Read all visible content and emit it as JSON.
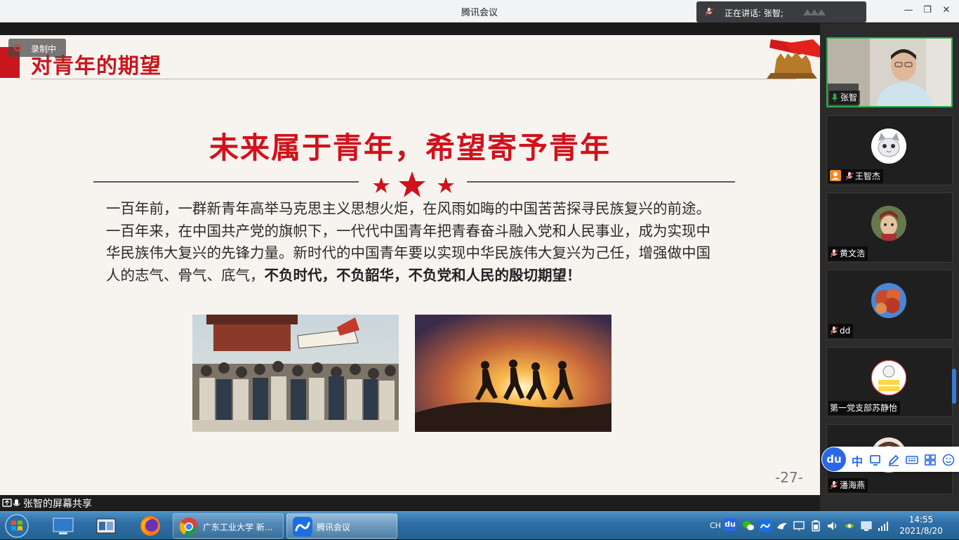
{
  "window": {
    "title": "腾讯会议",
    "speaking_text": "正在讲话: 张智;",
    "controls": [
      "—",
      "❐",
      "✕"
    ]
  },
  "slide": {
    "recording_label": "录制中",
    "heading": "对青年的期望",
    "main_title": "未来属于青年，希望寄予青年",
    "paragraph_normal": "一百年前，一群新青年高举马克思主义思想火炬，在风雨如晦的中国苦苦探寻民族复兴的前途。一百年来，在中国共产党的旗帜下，一代代中国青年把青春奋斗融入党和人民事业，成为实现中华民族伟大复兴的先锋力量。新时代的中国青年要以实现中华民族伟大复兴为己任，增强做中国人的志气、骨气、底气，",
    "paragraph_bold": "不负时代，不负韶华，不负党和人民的殷切期望！",
    "page_number": "-27-"
  },
  "screen_share": {
    "label": "张智的屏幕共享"
  },
  "participants": [
    {
      "name": "张智",
      "active": true
    },
    {
      "name": "王智杰",
      "active": false
    },
    {
      "name": "黄文浩",
      "active": false
    },
    {
      "name": "dd",
      "active": false
    },
    {
      "name": "第一党支部苏静怡",
      "active": false
    },
    {
      "name": "潘海燕",
      "active": false
    }
  ],
  "ime": {
    "logo": "du",
    "mode": "中"
  },
  "taskbar": {
    "tasks": [
      {
        "label": "广东工业大学 新..."
      },
      {
        "label": "腾讯会议"
      }
    ],
    "tray_lang": "CH",
    "tray_ime": "du",
    "time": "14:55",
    "date": "2021/8/20"
  },
  "colors": {
    "accent_red": "#c8161d",
    "active_green": "#2ab04a",
    "taskbar_blue": "#2f6fa6"
  }
}
